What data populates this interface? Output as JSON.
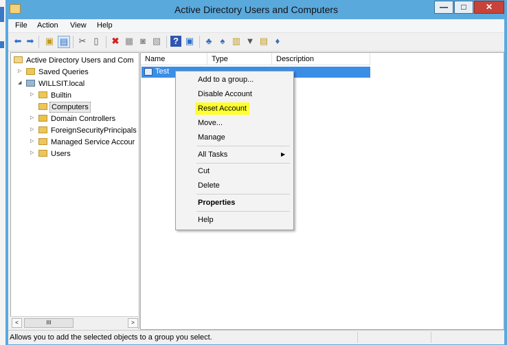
{
  "window": {
    "title": "Active Directory Users and Computers",
    "controls": {
      "minimize": "—",
      "maximize": "□",
      "close": "✕"
    }
  },
  "menubar": {
    "items": [
      "File",
      "Action",
      "View",
      "Help"
    ]
  },
  "toolbar": {
    "icons": [
      "back-icon",
      "forward-icon",
      "up-folder-icon",
      "show-hide-tree-icon",
      "cut-icon",
      "copy-icon",
      "delete-icon",
      "properties-icon",
      "refresh-icon",
      "export-icon",
      "help-icon",
      "console-icon",
      "new-user-icon",
      "new-group-icon",
      "new-ou-icon",
      "filter-icon",
      "find-icon",
      "add-to-group-icon"
    ]
  },
  "tree": {
    "root": "Active Directory Users and Com",
    "saved_queries": "Saved Queries",
    "domain": "WILLSIT.local",
    "children": [
      "Builtin",
      "Computers",
      "Domain Controllers",
      "ForeignSecurityPrincipals",
      "Managed Service Accour",
      "Users"
    ]
  },
  "scroll": {
    "left": "<",
    "thumb": "III",
    "right": ">"
  },
  "list": {
    "columns": [
      "Name",
      "Type",
      "Description"
    ],
    "rows": [
      {
        "name": "Test"
      }
    ]
  },
  "context_menu": {
    "items": [
      "Add to a group...",
      "Disable Account",
      "Reset Account",
      "Move...",
      "Manage",
      "All Tasks",
      "Cut",
      "Delete",
      "Properties",
      "Help"
    ],
    "highlight_color": "#ffff30"
  },
  "status": {
    "text": "Allows you to add the selected objects to a group you select."
  },
  "colors": {
    "accent": "#5aa9dd",
    "selection": "#3a8ee6",
    "close": "#c7433a"
  }
}
